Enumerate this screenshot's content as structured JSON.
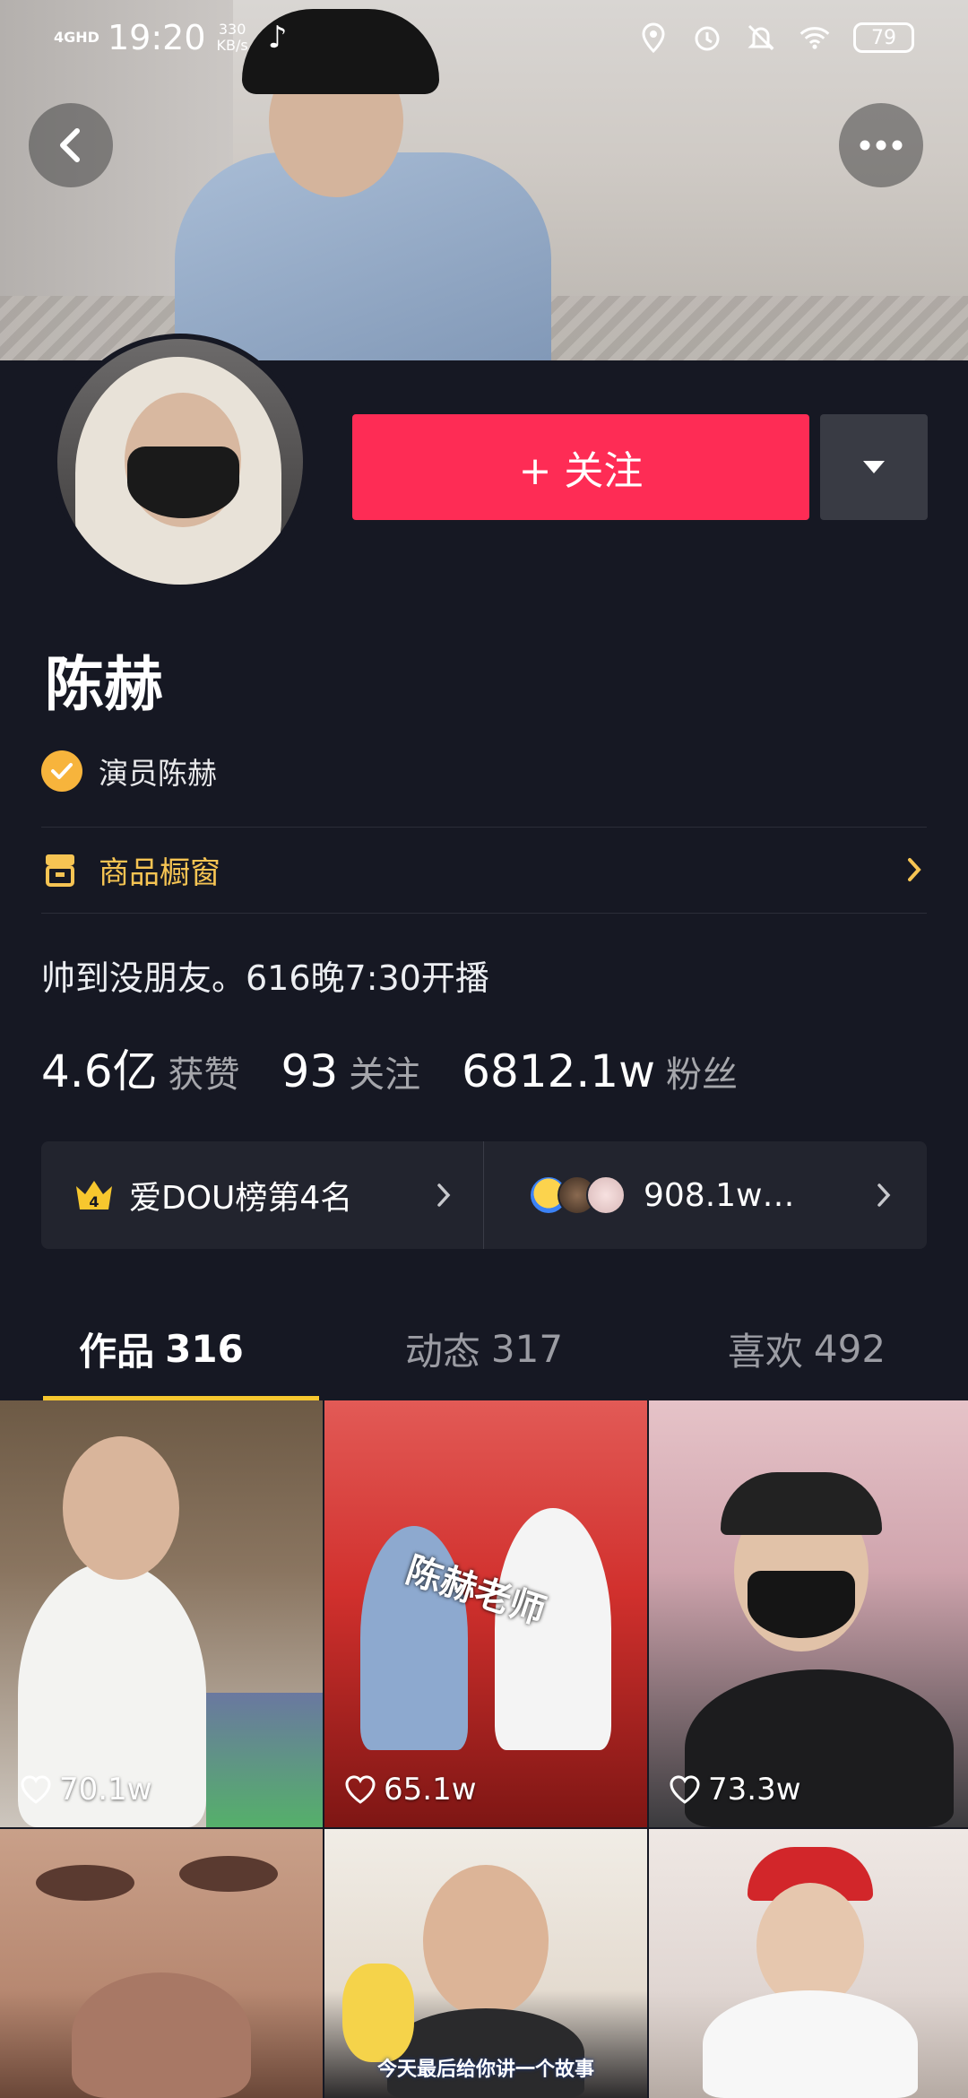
{
  "status_bar": {
    "signal": "4GHD",
    "time": "19:20",
    "speed_value": "330",
    "speed_unit": "KB/s",
    "battery": "79"
  },
  "profile": {
    "name": "陈赫",
    "verified_label": "演员陈赫",
    "follow_label": "+ 关注",
    "shop_label": "商品橱窗",
    "bio": "帅到没朋友。616晚7:30开播"
  },
  "stats": [
    {
      "value": "4.6亿",
      "label": "获赞"
    },
    {
      "value": "93",
      "label": "关注"
    },
    {
      "value": "6812.1w",
      "label": "粉丝"
    }
  ],
  "rank": {
    "crown_number": "4",
    "label": "爱DOU榜第4名",
    "fans_label": "908.1w…"
  },
  "tabs": [
    {
      "label": "作品",
      "count": "316"
    },
    {
      "label": "动态",
      "count": "317"
    },
    {
      "label": "喜欢",
      "count": "492"
    }
  ],
  "videos": [
    {
      "likes": "70.1w"
    },
    {
      "likes": "65.1w",
      "caption": "陈赫老师"
    },
    {
      "likes": "73.3w"
    },
    {},
    {
      "caption": "今天最后给你讲一个故事"
    },
    {}
  ],
  "colors": {
    "background": "#161823",
    "follow": "#fe2c55",
    "accent": "#f7c72e",
    "shop": "#f6c453"
  }
}
